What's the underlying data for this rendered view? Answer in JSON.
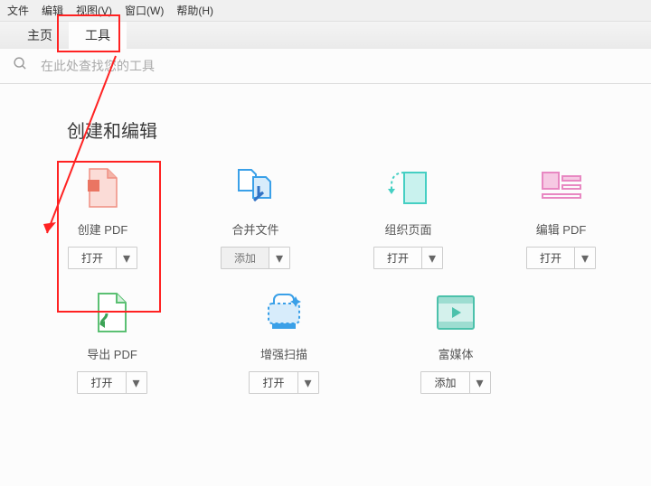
{
  "menubar": {
    "file": "文件",
    "edit": "编辑",
    "view": "视图(V)",
    "window": "窗口(W)",
    "help": "帮助(H)"
  },
  "tabs": {
    "home": "主页",
    "tools": "工具"
  },
  "search": {
    "placeholder": "在此处查找您的工具"
  },
  "section_title": "创建和编辑",
  "actions": {
    "open": "打开",
    "add": "添加",
    "caret": "▾"
  },
  "tools": {
    "create_pdf": "创建 PDF",
    "combine": "合并文件",
    "organize": "组织页面",
    "edit_pdf": "编辑 PDF",
    "export_pdf": "导出 PDF",
    "enhance_scan": "增强扫描",
    "rich_media": "富媒体"
  }
}
